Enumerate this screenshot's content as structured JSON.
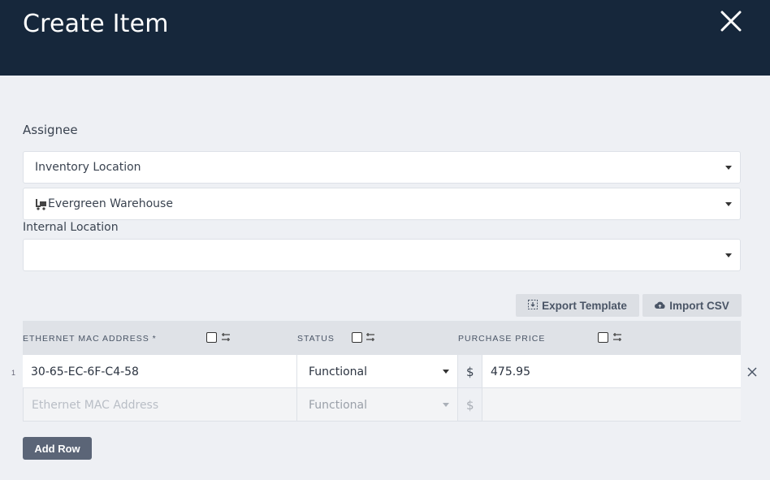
{
  "header": {
    "title": "Create Item"
  },
  "assignee": {
    "label": "Assignee",
    "type_select": "Inventory Location",
    "location_select": "Evergreen Warehouse"
  },
  "internal_location": {
    "label": "Internal Location",
    "value": ""
  },
  "toolbar": {
    "export_label": "Export Template",
    "import_label": "Import CSV"
  },
  "grid": {
    "columns": [
      "ETHERNET MAC ADDRESS *",
      "STATUS",
      "PURCHASE PRICE"
    ],
    "rows": [
      {
        "num": "1",
        "mac": "30-65-EC-6F-C4-58",
        "status": "Functional",
        "currency": "$",
        "price": "475.95"
      }
    ],
    "new_row": {
      "mac_placeholder": "Ethernet MAC Address",
      "status": "Functional",
      "currency": "$"
    }
  },
  "footer": {
    "add_row_label": "Add Row"
  }
}
